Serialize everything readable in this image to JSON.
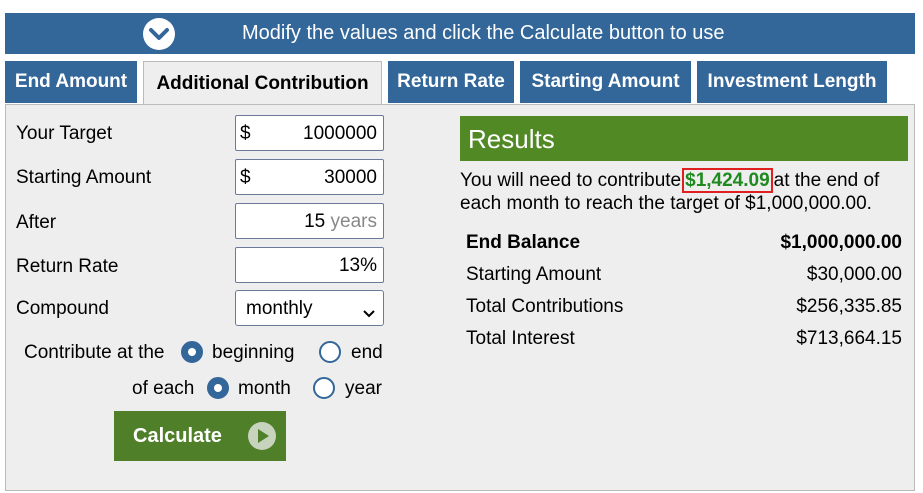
{
  "banner": {
    "icon": "chevron-down-circle-icon",
    "text": "Modify the values and click the Calculate button to use"
  },
  "tabs": [
    {
      "label": "End Amount",
      "active": false
    },
    {
      "label": "Additional Contribution",
      "active": true
    },
    {
      "label": "Return Rate",
      "active": false
    },
    {
      "label": "Starting Amount",
      "active": false
    },
    {
      "label": "Investment Length",
      "active": false
    }
  ],
  "form": {
    "target": {
      "label": "Your Target",
      "prefix": "$",
      "value": "1000000"
    },
    "starting": {
      "label": "Starting Amount",
      "prefix": "$",
      "value": "30000"
    },
    "after": {
      "label": "After",
      "value": "15",
      "unit": "years"
    },
    "rate": {
      "label": "Return Rate",
      "value": "13",
      "unit": "%"
    },
    "compound": {
      "label": "Compound",
      "value": "monthly"
    },
    "contribute_at": {
      "label": "Contribute at the",
      "options": [
        "beginning",
        "end"
      ],
      "selected": "beginning"
    },
    "of_each": {
      "label": "of each",
      "options": [
        "month",
        "year"
      ],
      "selected": "month"
    },
    "calculate_label": "Calculate"
  },
  "results": {
    "title": "Results",
    "line1_pre": "You will need to contribute",
    "amount": "$1,424.09",
    "line1_post": "at the end of",
    "line2": "each month to reach the target of $1,000,000.00.",
    "rows": [
      {
        "label": "End Balance",
        "value": "$1,000,000.00",
        "bold": true
      },
      {
        "label": "Starting Amount",
        "value": "$30,000.00",
        "bold": false
      },
      {
        "label": "Total Contributions",
        "value": "$256,335.85",
        "bold": false
      },
      {
        "label": "Total Interest",
        "value": "$713,664.15",
        "bold": false
      }
    ]
  },
  "colors": {
    "tab_blue": "#336699",
    "result_green": "#518a24",
    "button_green": "#4f7f28",
    "highlight_red": "#e02020"
  }
}
